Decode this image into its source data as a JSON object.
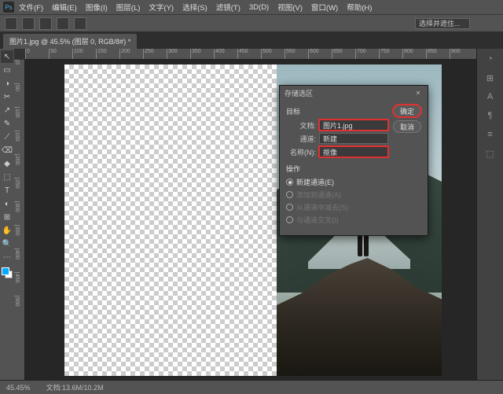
{
  "menu": {
    "items": [
      "文件(F)",
      "编辑(E)",
      "图像(I)",
      "图层(L)",
      "文字(Y)",
      "选择(S)",
      "滤镜(T)",
      "3D(D)",
      "视图(V)",
      "窗口(W)",
      "帮助(H)"
    ],
    "logo": "Ps"
  },
  "optbar": {
    "selector": "选择并遮住..."
  },
  "tab": {
    "label": "图片1.jpg @ 45.5% (图层 0, RGB/8#) *"
  },
  "ruler_h": [
    "0",
    "50",
    "100",
    "150",
    "200",
    "250",
    "300",
    "350",
    "400",
    "450",
    "500",
    "550",
    "600",
    "650",
    "700",
    "750",
    "800",
    "850",
    "900"
  ],
  "ruler_v": [
    "0",
    "50",
    "100",
    "150",
    "200",
    "250",
    "300",
    "350",
    "400",
    "450",
    "500"
  ],
  "tools": [
    "↖",
    "▭",
    "◑",
    "✂",
    "↗",
    "✎",
    "⟋",
    "⌫",
    "◆",
    "⬚",
    "≡",
    "T",
    "◐",
    "⊞",
    "✋",
    "🔍",
    "⋯"
  ],
  "rpanel": [
    "◔",
    "⊞",
    "A",
    "¶",
    "≡",
    "⬚"
  ],
  "dialog": {
    "title": "存储选区",
    "sect1": "目标",
    "doc_lbl": "文档:",
    "doc_val": "图片1.jpg",
    "chan_lbl": "通道:",
    "chan_val": "新建",
    "name_lbl": "名称(N):",
    "name_val": "抠像",
    "sect2": "操作",
    "op1": "新建通道(E)",
    "op2": "添加到通道(A)",
    "op3": "从通道中减去(S)",
    "op4": "与通道交叉(I)",
    "ok": "确定",
    "cancel": "取消"
  },
  "status": {
    "zoom": "45.45%",
    "doc": "文档:13.6M/10.2M"
  }
}
